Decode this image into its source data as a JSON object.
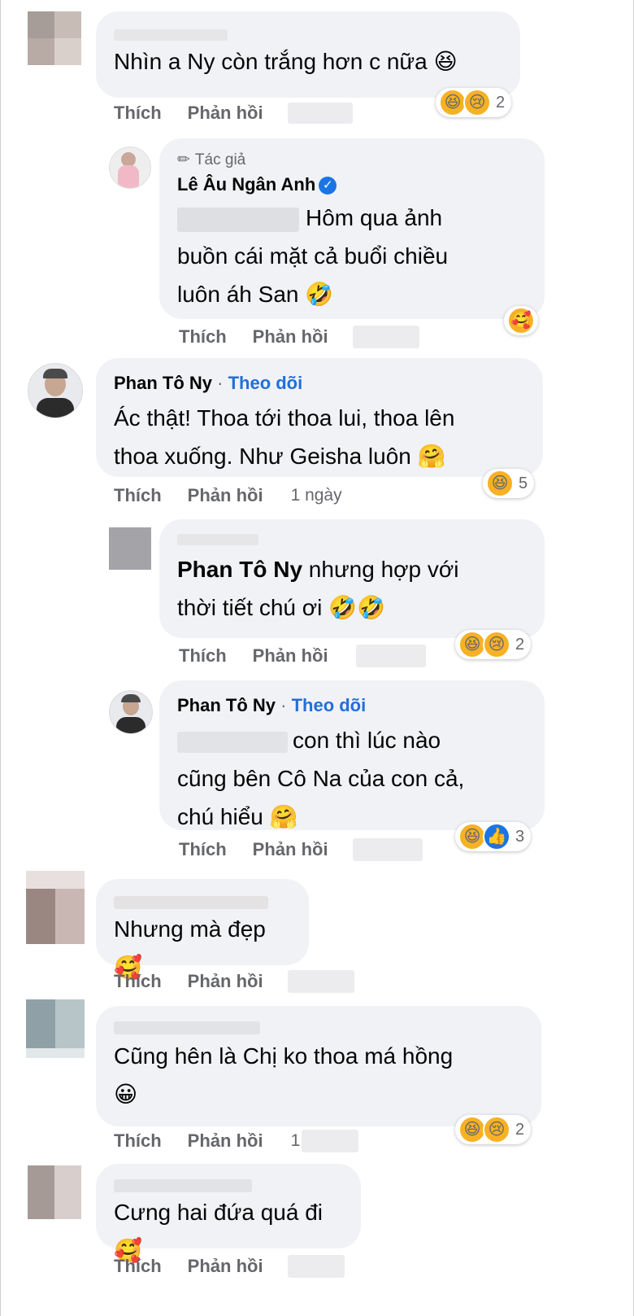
{
  "actions": {
    "like": "Thích",
    "reply": "Phản hồi"
  },
  "comments": [
    {
      "text": "Nhìn a Ny còn trắng hơn c nữa 😆",
      "reaction_count": "2"
    },
    {
      "author_tag": "Tác giả",
      "name": "Lê Âu Ngân Anh",
      "text_lines": [
        "Hôm qua ảnh",
        "buồn cái mặt cả buổi chiều",
        "luôn áh San 🤣"
      ]
    },
    {
      "name": "Phan Tô Ny",
      "follow": "Theo dõi",
      "text_lines": [
        "Ác thật! Thoa tới thoa lui, thoa lên",
        "thoa xuống. Như Geisha luôn 🤗"
      ],
      "reaction_count": "5",
      "time": "1 ngày"
    },
    {
      "mention": "Phan Tô Ny",
      "text_lines": [
        "nhưng hợp với",
        "thời tiết chú ơi 🤣🤣"
      ],
      "reaction_count": "2"
    },
    {
      "name": "Phan Tô Ny",
      "follow": "Theo dõi",
      "text_lines": [
        "con thì lúc nào",
        "cũng bên Cô Na của con cả,",
        "chú hiểu 🤗"
      ],
      "reaction_count": "3"
    },
    {
      "text": "Nhưng mà đẹp 🥰"
    },
    {
      "text_lines": [
        "Cũng hên là Chị ko thoa má hồng",
        "😀"
      ],
      "reaction_count": "2",
      "time_partial": "1"
    },
    {
      "text": "Cưng hai đứa quá đi 🥰"
    }
  ]
}
